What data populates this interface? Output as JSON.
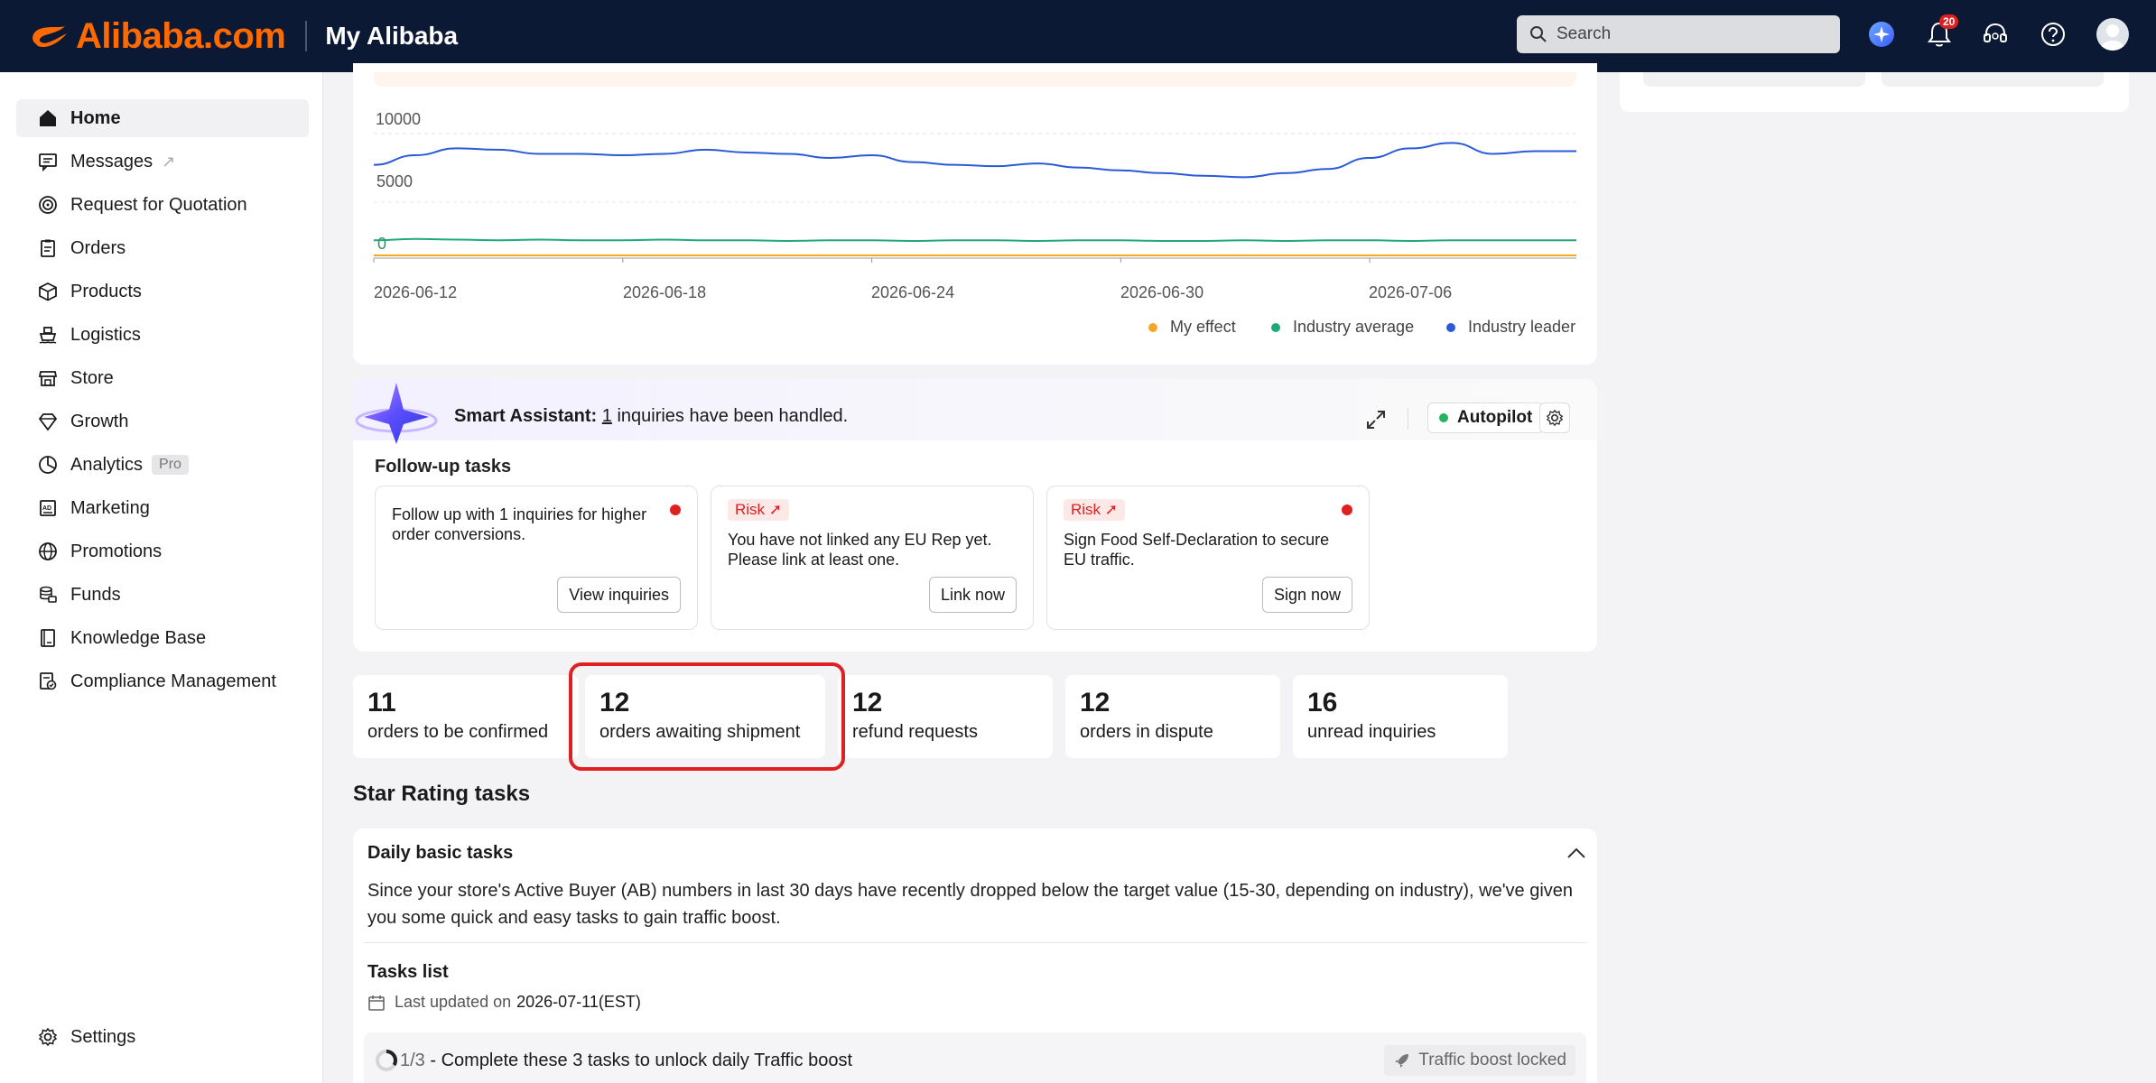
{
  "header": {
    "brand": "Alibaba.com",
    "title": "My Alibaba",
    "search_placeholder": "Search",
    "notification_count": "20"
  },
  "sidebar": {
    "items": [
      {
        "label": "Home",
        "icon": "home-icon",
        "active": true
      },
      {
        "label": "Messages",
        "icon": "message-icon",
        "suffix": "↗"
      },
      {
        "label": "Request for Quotation",
        "icon": "target-icon"
      },
      {
        "label": "Orders",
        "icon": "clipboard-icon"
      },
      {
        "label": "Products",
        "icon": "box-icon"
      },
      {
        "label": "Logistics",
        "icon": "ship-icon"
      },
      {
        "label": "Store",
        "icon": "store-icon"
      },
      {
        "label": "Growth",
        "icon": "diamond-icon"
      },
      {
        "label": "Analytics",
        "icon": "pie-chart-icon",
        "badge": "Pro"
      },
      {
        "label": "Marketing",
        "icon": "ad-icon"
      },
      {
        "label": "Promotions",
        "icon": "globe-icon"
      },
      {
        "label": "Funds",
        "icon": "coins-icon"
      },
      {
        "label": "Knowledge Base",
        "icon": "book-icon"
      },
      {
        "label": "Compliance Management",
        "icon": "compliance-icon"
      }
    ],
    "settings_label": "Settings"
  },
  "chart_data": {
    "type": "line",
    "x_ticks": [
      "2026-06-12",
      "2026-06-18",
      "2026-06-24",
      "2026-06-30",
      "2026-07-06"
    ],
    "y_ticks": [
      "10000",
      "5000",
      "0"
    ],
    "ylim": [
      0,
      10000
    ],
    "series": [
      {
        "name": "My effect",
        "color": "#f5a623",
        "values": [
          200,
          200,
          200,
          200,
          200,
          200,
          200,
          200,
          200,
          200,
          200,
          200,
          200,
          200,
          200,
          200,
          200,
          200,
          200,
          200,
          200,
          200,
          200,
          200,
          200,
          200,
          200,
          200,
          200,
          200
        ]
      },
      {
        "name": "Industry average",
        "color": "#1fa97a",
        "values": [
          1300,
          1400,
          1350,
          1300,
          1350,
          1300,
          1300,
          1350,
          1300,
          1300,
          1250,
          1300,
          1300,
          1250,
          1300,
          1300,
          1250,
          1300,
          1300,
          1250,
          1250,
          1300,
          1250,
          1300,
          1300,
          1250,
          1300,
          1300,
          1300,
          1300
        ]
      },
      {
        "name": "Industry leader",
        "color": "#2a5bd7",
        "values": [
          6800,
          7500,
          8000,
          7900,
          7600,
          7600,
          7500,
          7600,
          7900,
          7700,
          7600,
          7300,
          7500,
          7000,
          6800,
          6700,
          6900,
          6600,
          6400,
          6200,
          6000,
          5900,
          6200,
          6500,
          7300,
          8000,
          8400,
          7600,
          7800,
          7800
        ]
      }
    ],
    "legend_position": "bottom-right"
  },
  "assistant": {
    "label": "Smart Assistant:",
    "count": "1",
    "message": " inquiries have been handled.",
    "autopilot_label": "Autopilot",
    "follow_up_title": "Follow-up tasks",
    "tasks": [
      {
        "risk": "",
        "text": "Follow up with 1 inquiries for higher order conversions.",
        "button": "View inquiries"
      },
      {
        "risk": "Risk",
        "text": "You have not linked any EU Rep yet. Please link at least one.",
        "button": "Link now"
      },
      {
        "risk": "Risk",
        "text": "Sign Food Self-Declaration to secure EU traffic.",
        "button": "Sign now"
      }
    ]
  },
  "stats": [
    {
      "value": "11",
      "label": "orders to be confirmed"
    },
    {
      "value": "12",
      "label": "orders awaiting shipment"
    },
    {
      "value": "12",
      "label": "refund requests"
    },
    {
      "value": "12",
      "label": "orders in dispute"
    },
    {
      "value": "16",
      "label": "unread inquiries"
    }
  ],
  "star_rating": {
    "title": "Star Rating tasks",
    "daily_title": "Daily basic tasks",
    "daily_desc": "Since your store's Active Buyer (AB) numbers in last 30 days have recently dropped below the target value (15-30, depending on industry), we've given you some quick and easy tasks to gain traffic boost.",
    "tasks_list_title": "Tasks list",
    "last_updated_label": "Last updated on",
    "last_updated_date": "2026-07-11(EST)",
    "progress_fraction": "1/3",
    "progress_text": " - Complete these 3 tasks to unlock daily Traffic boost",
    "progress_value": 0.333,
    "locked_label": "Traffic boost locked"
  },
  "colors": {
    "header_bg": "#0c1934",
    "brand_orange": "#ff6a00",
    "risk_red": "#e02020"
  }
}
